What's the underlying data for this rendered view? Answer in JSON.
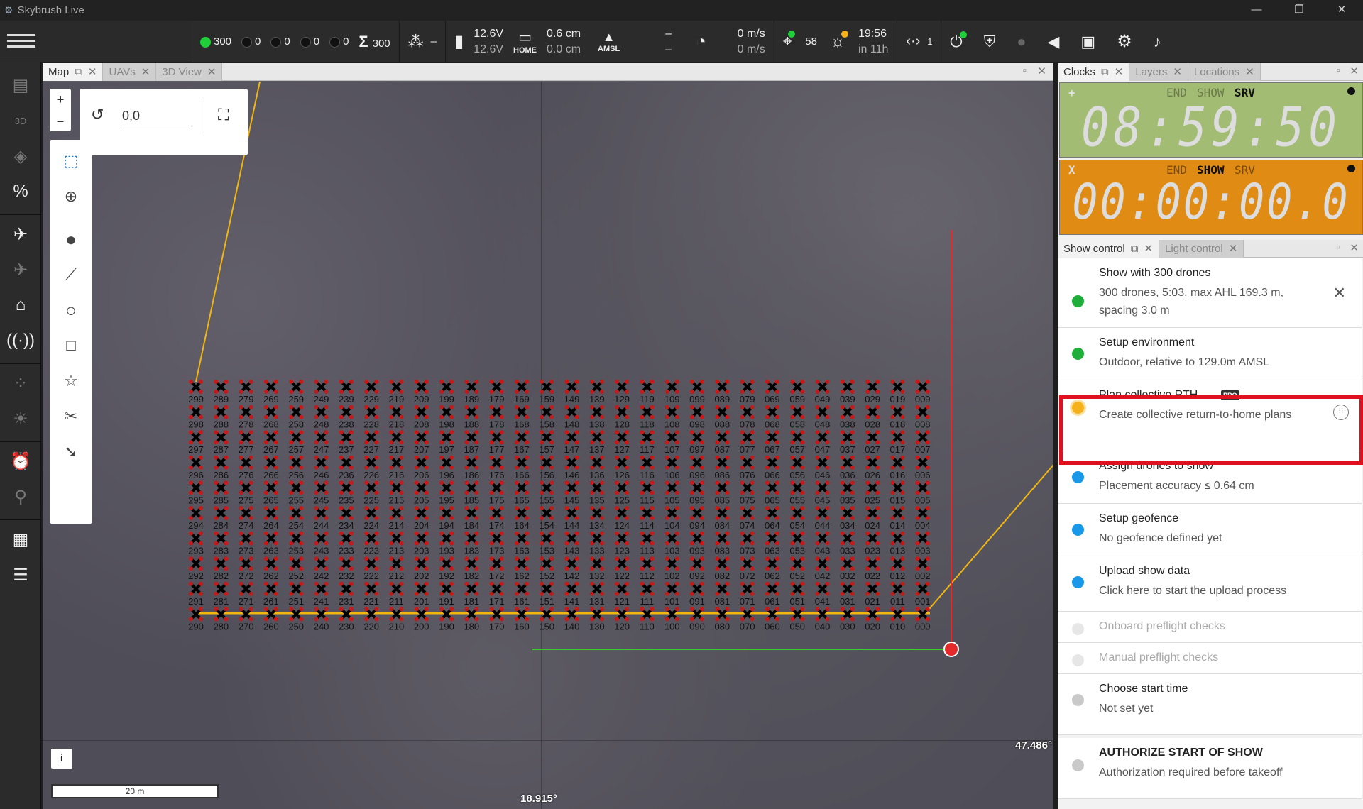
{
  "window": {
    "title": "Skybrush Live",
    "minimize": "—",
    "restore": "❐",
    "close": "✕"
  },
  "status": {
    "uav_count_green": "300",
    "uav_count_2": "0",
    "uav_count_3": "0",
    "uav_count_4": "0",
    "uav_count_5": "0",
    "total_uavs": "300",
    "cluster_value": "–",
    "battery_top": "12.6V",
    "battery_bottom": "12.6V",
    "home_label": "HOME",
    "home_top": "0.6 cm",
    "home_bottom": "0.0 cm",
    "amsl_label": "AMSL",
    "amsl_top": "–",
    "amsl_bottom": "–",
    "speed_top": "0 m/s",
    "speed_bottom": "0 m/s",
    "satellites": "58",
    "sun_time": "19:56",
    "sun_rel": "in 11h",
    "rtk_badge": "1"
  },
  "map_tabs": [
    "Map",
    "UAVs",
    "3D View"
  ],
  "map": {
    "rotation_value": "0,0",
    "zoom_in": "+",
    "zoom_out": "–",
    "info_label": "i",
    "scale_label": "20 m",
    "lon_label": "18.915°",
    "lat_label": "47.486°",
    "grid_columns": [
      "299",
      "289",
      "279",
      "269",
      "259",
      "249",
      "239",
      "229",
      "219",
      "209",
      "199",
      "189",
      "179",
      "169",
      "159",
      "149",
      "139",
      "129",
      "119",
      "109",
      "099",
      "089",
      "079",
      "069",
      "059",
      "049",
      "039",
      "029",
      "019",
      "009"
    ],
    "grid_rows_last_digit": [
      "9",
      "8",
      "7",
      "6",
      "5",
      "4",
      "3",
      "2",
      "1",
      "0"
    ]
  },
  "clock_tabs": [
    "Clocks",
    "Layers",
    "Locations"
  ],
  "clocks": [
    {
      "marker": "+",
      "end": "END",
      "show": "SHOW",
      "srv": "SRV",
      "time": "08:59:50",
      "bg": "#a2bc73"
    },
    {
      "marker": "X",
      "end": "END",
      "show": "SHOW",
      "srv": "SRV",
      "time": "00:00:00.0",
      "bg": "#e08c14"
    }
  ],
  "show_tabs": [
    "Show control",
    "Light control"
  ],
  "show_steps": [
    {
      "title": "Show with 300 drones",
      "sub": "300 drones, 5:03, max AHL 169.3 m, spacing 3.0 m",
      "color": "#1fae3a"
    },
    {
      "title": "Setup environment",
      "sub": "Outdoor, relative to 129.0m AMSL",
      "color": "#1fae3a"
    },
    {
      "title": "Plan collective RTH",
      "badge": "PRO",
      "sub": "Create collective return-to-home plans",
      "color": "#f6b21a"
    },
    {
      "title": "Assign drones to show",
      "sub": "Placement accuracy ≤ 0.64 cm",
      "color": "#1a98e8"
    },
    {
      "title": "Setup geofence",
      "sub": "No geofence defined yet",
      "color": "#1a98e8"
    },
    {
      "title": "Upload show data",
      "sub": "Click here to start the upload process",
      "color": "#1a98e8"
    },
    {
      "title": "Onboard preflight checks",
      "sub": "",
      "color": "#e6e6e6"
    },
    {
      "title": "Manual preflight checks",
      "sub": "",
      "color": "#e6e6e6"
    },
    {
      "title": "Choose start time",
      "sub": "Not set yet",
      "color": "#c9c9c9"
    },
    {
      "title": "AUTHORIZE START OF SHOW",
      "sub": "Authorization required before takeoff",
      "color": "#c9c9c9"
    }
  ]
}
